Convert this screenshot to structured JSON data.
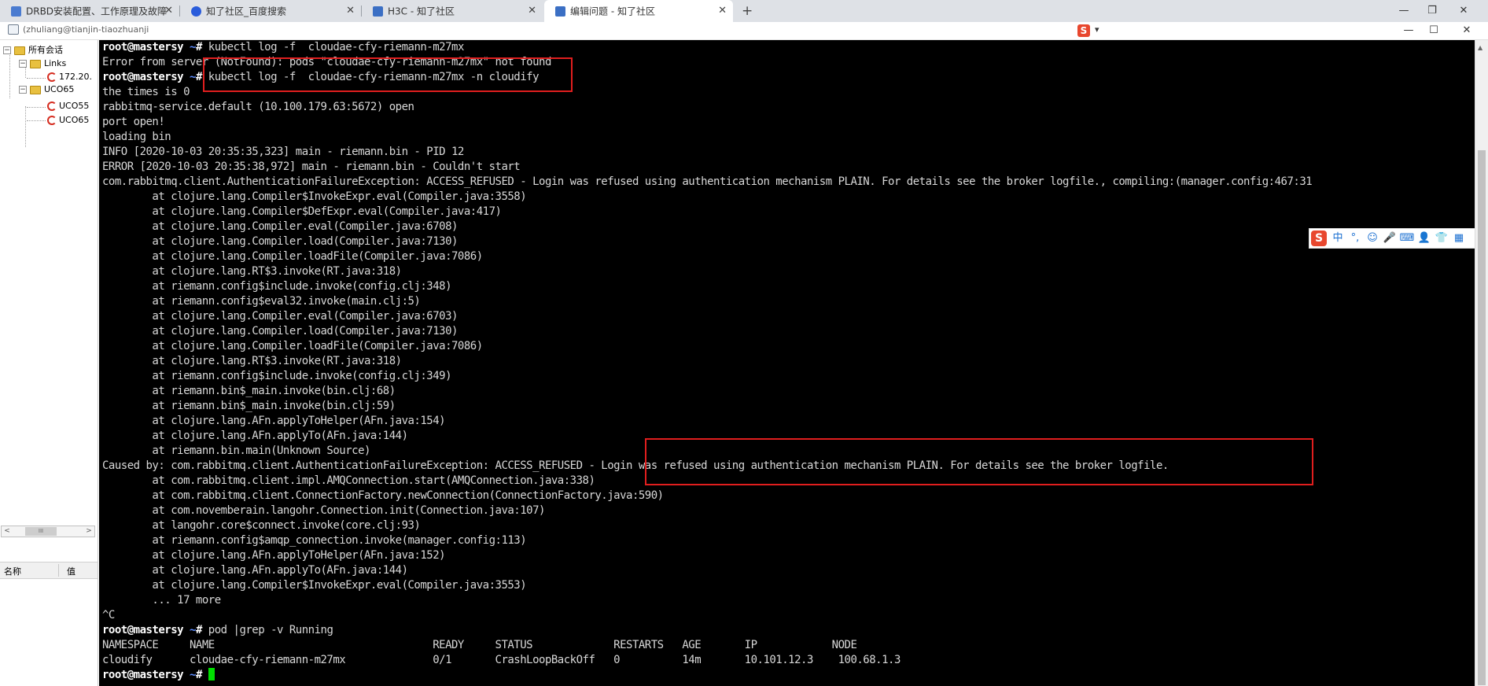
{
  "browser": {
    "tabs": [
      {
        "title": "DRBD安装配置、工作原理及故障",
        "favicon_color": "#4a7bd0"
      },
      {
        "title": "知了社区_百度搜索",
        "favicon_color": "#2a5cdb"
      },
      {
        "title": "H3C - 知了社区",
        "favicon_color": "#3b6fc4"
      },
      {
        "title": "编辑问题 - 知了社区",
        "favicon_color": "#3b6fc4",
        "active": true
      }
    ],
    "new_tab_glyph": "+",
    "close_glyph": "✕",
    "window_controls": [
      "—",
      "❐",
      "✕"
    ]
  },
  "session": {
    "title": "(zhuliang@tianjin-tiaozhuanji",
    "ime_logo": "S",
    "ime_arrow": "▾",
    "window_controls": [
      "—",
      "☐",
      "✕"
    ]
  },
  "tree": {
    "root": "所有会话",
    "links_folder": "Links",
    "links_items": [
      "172.20."
    ],
    "uco_folder": "UCO65",
    "uco_items": [
      "UCO55",
      "UCO65"
    ],
    "expander_minus": "−",
    "scroll_left": "<",
    "scroll_right": ">",
    "scroll_thumb": "III"
  },
  "properties": {
    "col_name": "名称",
    "col_value": "值"
  },
  "terminal": {
    "prompt_user": "root@mastersy",
    "prompt_path": " ~",
    "prompt_sign": "# ",
    "lines": [
      {
        "kind": "cmd",
        "text": "kubectl log -f  cloudae-cfy-riemann-m27mx"
      },
      {
        "kind": "out",
        "text": "Error from server (NotFound): pods \"cloudae-cfy-riemann-m27mx\" not found"
      },
      {
        "kind": "cmd",
        "text": "kubectl log -f  cloudae-cfy-riemann-m27mx -n cloudify"
      },
      {
        "kind": "out",
        "text": "the times is 0"
      },
      {
        "kind": "out",
        "text": "rabbitmq-service.default (10.100.179.63:5672) open"
      },
      {
        "kind": "out",
        "text": "port open!"
      },
      {
        "kind": "out",
        "text": "loading bin"
      },
      {
        "kind": "out",
        "text": "INFO [2020-10-03 20:35:35,323] main - riemann.bin - PID 12"
      },
      {
        "kind": "out",
        "text": "ERROR [2020-10-03 20:35:38,972] main - riemann.bin - Couldn't start"
      },
      {
        "kind": "out",
        "text": "com.rabbitmq.client.AuthenticationFailureException: ACCESS_REFUSED - Login was refused using authentication mechanism PLAIN. For details see the broker logfile., compiling:(manager.config:467:31"
      },
      {
        "kind": "out",
        "text": "        at clojure.lang.Compiler$InvokeExpr.eval(Compiler.java:3558)"
      },
      {
        "kind": "out",
        "text": "        at clojure.lang.Compiler$DefExpr.eval(Compiler.java:417)"
      },
      {
        "kind": "out",
        "text": "        at clojure.lang.Compiler.eval(Compiler.java:6708)"
      },
      {
        "kind": "out",
        "text": "        at clojure.lang.Compiler.load(Compiler.java:7130)"
      },
      {
        "kind": "out",
        "text": "        at clojure.lang.Compiler.loadFile(Compiler.java:7086)"
      },
      {
        "kind": "out",
        "text": "        at clojure.lang.RT$3.invoke(RT.java:318)"
      },
      {
        "kind": "out",
        "text": "        at riemann.config$include.invoke(config.clj:348)"
      },
      {
        "kind": "out",
        "text": "        at riemann.config$eval32.invoke(main.clj:5)"
      },
      {
        "kind": "out",
        "text": "        at clojure.lang.Compiler.eval(Compiler.java:6703)"
      },
      {
        "kind": "out",
        "text": "        at clojure.lang.Compiler.load(Compiler.java:7130)"
      },
      {
        "kind": "out",
        "text": "        at clojure.lang.Compiler.loadFile(Compiler.java:7086)"
      },
      {
        "kind": "out",
        "text": "        at clojure.lang.RT$3.invoke(RT.java:318)"
      },
      {
        "kind": "out",
        "text": "        at riemann.config$include.invoke(config.clj:349)"
      },
      {
        "kind": "out",
        "text": "        at riemann.bin$_main.invoke(bin.clj:68)"
      },
      {
        "kind": "out",
        "text": "        at riemann.bin$_main.invoke(bin.clj:59)"
      },
      {
        "kind": "out",
        "text": "        at clojure.lang.AFn.applyToHelper(AFn.java:154)"
      },
      {
        "kind": "out",
        "text": "        at clojure.lang.AFn.applyTo(AFn.java:144)"
      },
      {
        "kind": "out",
        "text": "        at riemann.bin.main(Unknown Source)"
      },
      {
        "kind": "out",
        "text": "Caused by: com.rabbitmq.client.AuthenticationFailureException: ACCESS_REFUSED - Login was refused using authentication mechanism PLAIN. For details see the broker logfile."
      },
      {
        "kind": "out",
        "text": "        at com.rabbitmq.client.impl.AMQConnection.start(AMQConnection.java:338)"
      },
      {
        "kind": "out",
        "text": "        at com.rabbitmq.client.ConnectionFactory.newConnection(ConnectionFactory.java:590)"
      },
      {
        "kind": "out",
        "text": "        at com.novemberain.langohr.Connection.init(Connection.java:107)"
      },
      {
        "kind": "out",
        "text": "        at langohr.core$connect.invoke(core.clj:93)"
      },
      {
        "kind": "out",
        "text": "        at riemann.config$amqp_connection.invoke(manager.config:113)"
      },
      {
        "kind": "out",
        "text": "        at clojure.lang.AFn.applyToHelper(AFn.java:152)"
      },
      {
        "kind": "out",
        "text": "        at clojure.lang.AFn.applyTo(AFn.java:144)"
      },
      {
        "kind": "out",
        "text": "        at clojure.lang.Compiler$InvokeExpr.eval(Compiler.java:3553)"
      },
      {
        "kind": "out",
        "text": "        ... 17 more"
      },
      {
        "kind": "out",
        "text": "^C"
      },
      {
        "kind": "cmd",
        "text": "pod |grep -v Running"
      },
      {
        "kind": "out",
        "text": "NAMESPACE     NAME                                   READY     STATUS             RESTARTS   AGE       IP            NODE"
      },
      {
        "kind": "out",
        "text": "cloudify      cloudae-cfy-riemann-m27mx              0/1       CrashLoopBackOff   0          14m       10.101.12.3    100.68.1.3"
      },
      {
        "kind": "cmd",
        "text": "",
        "cursor": true
      }
    ]
  },
  "ime_toolbar": {
    "logo": "S",
    "buttons": [
      "中",
      "°,",
      "☺",
      "🎤",
      "⌨",
      "👤",
      "👕",
      "▦"
    ]
  },
  "colors": {
    "terminal_bg": "#000000",
    "terminal_fg": "#d8d8d8",
    "prompt_path": "#5c8cff",
    "cursor": "#00e000",
    "highlight_box": "#e01e1e"
  }
}
